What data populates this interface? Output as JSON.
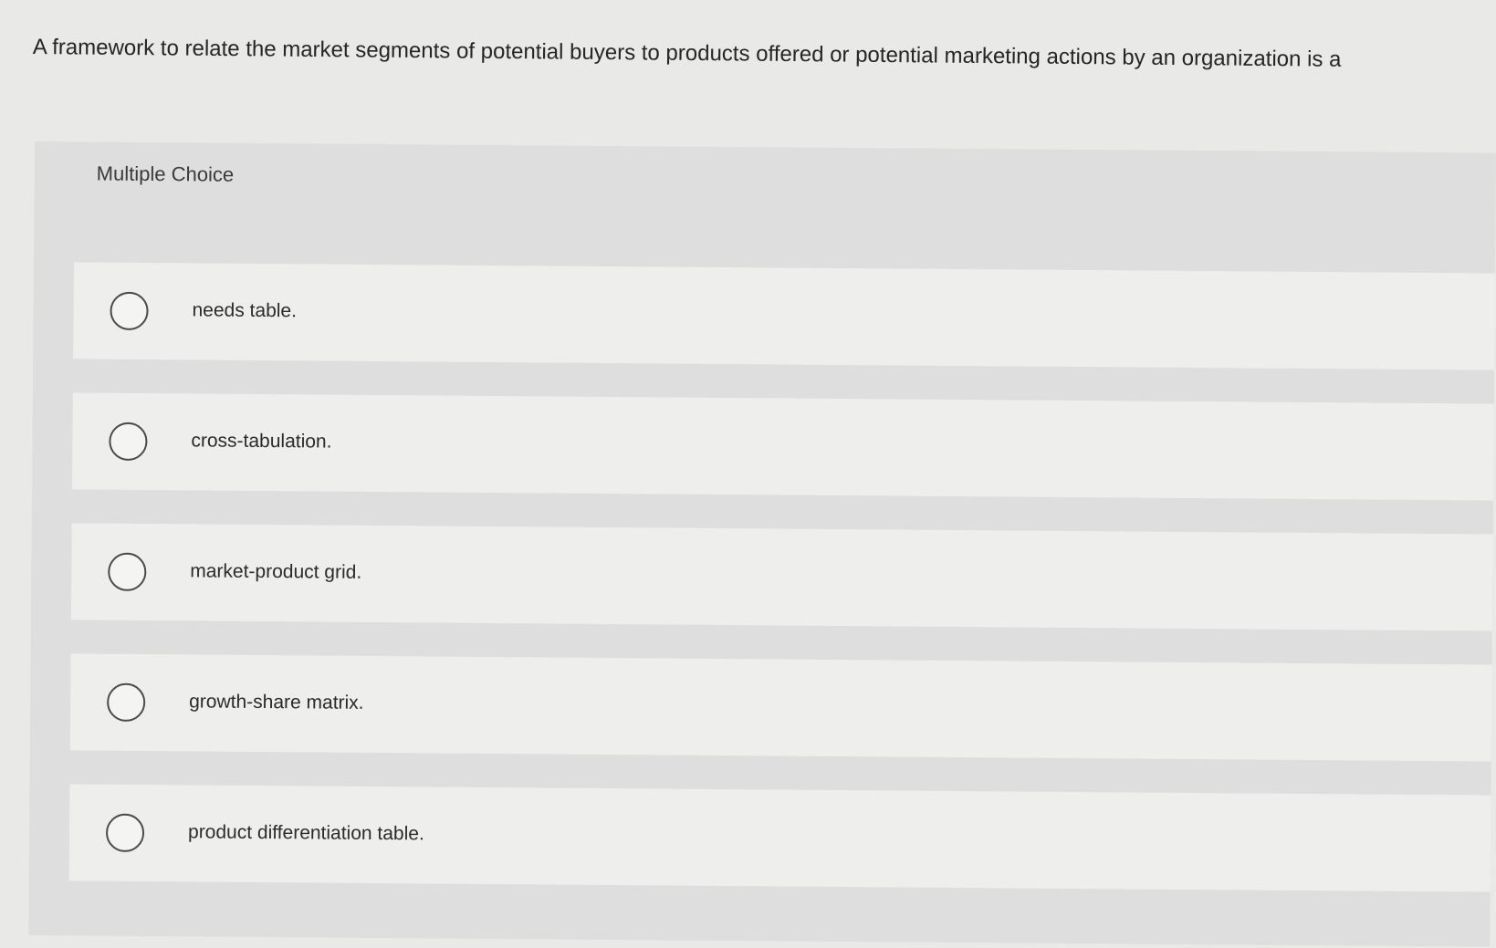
{
  "question": {
    "text": "A framework to relate the market segments of potential buyers to products offered or potential marketing actions by an organization is a"
  },
  "multiple_choice": {
    "label": "Multiple Choice",
    "options": [
      {
        "label": "needs table."
      },
      {
        "label": "cross-tabulation."
      },
      {
        "label": "market-product grid."
      },
      {
        "label": "growth-share matrix."
      },
      {
        "label": "product differentiation table."
      }
    ]
  }
}
